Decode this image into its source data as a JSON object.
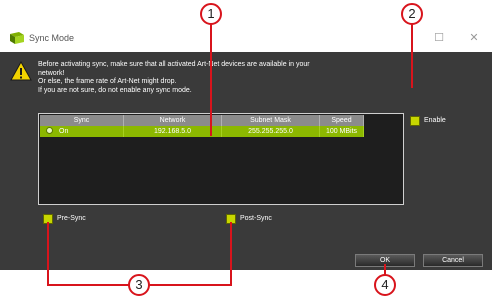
{
  "window": {
    "title": "Sync Mode",
    "maximize_glyph": "☐",
    "close_glyph": "✕"
  },
  "warning": {
    "line1": "Before activating sync, make sure that all activated Art-Net devices are available in your",
    "line2": "network!",
    "line3": "Or else, the frame rate of Art-Net might drop.",
    "line4": "If you are not sure, do not enable any sync mode."
  },
  "table": {
    "headers": [
      "Sync",
      "Network",
      "Subnet Mask",
      "Speed"
    ],
    "rows": [
      {
        "sync": "On",
        "network": "192.168.5.0",
        "subnet_mask": "255.255.255.0",
        "speed": "100 MBits"
      }
    ]
  },
  "options": {
    "enable_label": "Enable",
    "pre_sync_label": "Pre-Sync",
    "post_sync_label": "Post-Sync"
  },
  "buttons": {
    "ok": "OK",
    "cancel": "Cancel"
  },
  "callouts": [
    "1",
    "2",
    "3",
    "4"
  ],
  "colors": {
    "accent_green": "#8cb800",
    "callout_red": "#d8141c",
    "dialog_bg": "#3a3a3a",
    "checkbox_yellow": "#c7d600"
  }
}
